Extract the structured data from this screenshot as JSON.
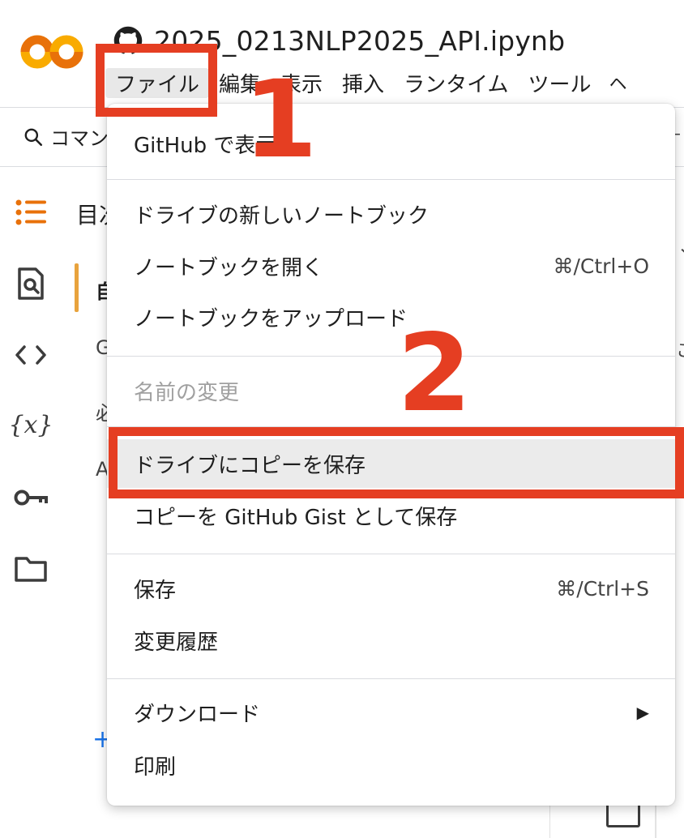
{
  "header": {
    "notebook_title": "2025_0213NLP2025_API.ipynb",
    "menu": [
      {
        "label": "ファイル"
      },
      {
        "label": "編集"
      },
      {
        "label": "表示"
      },
      {
        "label": "挿入"
      },
      {
        "label": "ランタイム"
      },
      {
        "label": "ツール"
      }
    ],
    "menu_overflow": "ヘ"
  },
  "toolbar": {
    "command_label": "コマン"
  },
  "sidebar": {
    "toc_title": "目次",
    "toc_items": [
      "自",
      "G",
      "必",
      "A"
    ]
  },
  "file_menu": {
    "items": [
      {
        "label": "GitHub で表示",
        "shortcut": ""
      },
      {
        "label": "ドライブの新しいノートブック",
        "shortcut": ""
      },
      {
        "label": "ノートブックを開く",
        "shortcut": "⌘/Ctrl+O"
      },
      {
        "label": "ノートブックをアップロード",
        "shortcut": ""
      },
      {
        "label": "名前の変更",
        "shortcut": "",
        "disabled": true
      },
      {
        "label": "ドライブにコピーを保存",
        "shortcut": "",
        "highlighted": true
      },
      {
        "label": "コピーを GitHub Gist として保存",
        "shortcut": ""
      },
      {
        "label": "保存",
        "shortcut": "⌘/Ctrl+S"
      },
      {
        "label": "変更履歴",
        "shortcut": ""
      },
      {
        "label": "ダウンロード",
        "shortcut": "",
        "submenu_arrow": "▶"
      },
      {
        "label": "印刷",
        "shortcut": ""
      }
    ]
  },
  "annotations": {
    "step1": "1",
    "step2": "2",
    "color": "#e53e22"
  },
  "colors": {
    "accent_orange": "#e8a33d",
    "link_blue": "#1a73e8",
    "highlight_bg": "#ebebeb"
  }
}
